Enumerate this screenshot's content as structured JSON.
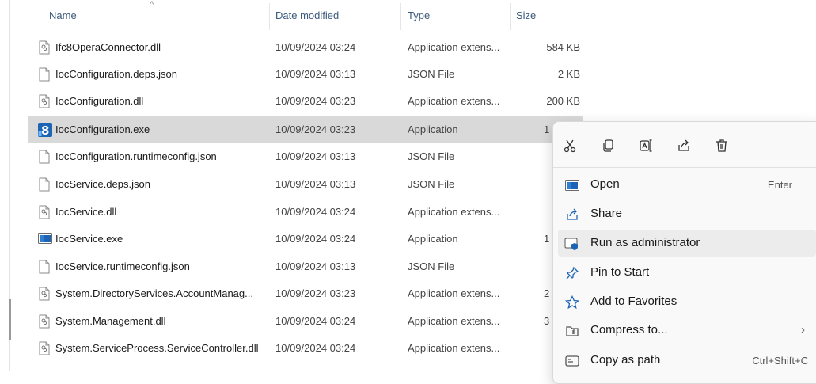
{
  "columns": {
    "name": "Name",
    "date": "Date modified",
    "type": "Type",
    "size": "Size"
  },
  "files": [
    {
      "name": "Ifc8OperaConnector.dll",
      "date": "10/09/2024 03:24",
      "type": "Application extens...",
      "size": "584 KB",
      "icon": "dll-icon"
    },
    {
      "name": "IocConfiguration.deps.json",
      "date": "10/09/2024 03:13",
      "type": "JSON File",
      "size": "2 KB",
      "icon": "json-file-icon"
    },
    {
      "name": "IocConfiguration.dll",
      "date": "10/09/2024 03:23",
      "type": "Application extens...",
      "size": "200 KB",
      "icon": "dll-icon"
    },
    {
      "name": "IocConfiguration.exe",
      "date": "10/09/2024 03:23",
      "type": "Application",
      "size": "1",
      "icon": "app-exe-icon"
    },
    {
      "name": "IocConfiguration.runtimeconfig.json",
      "date": "10/09/2024 03:13",
      "type": "JSON File",
      "size": "",
      "icon": "json-file-icon"
    },
    {
      "name": "IocService.deps.json",
      "date": "10/09/2024 03:13",
      "type": "JSON File",
      "size": "",
      "icon": "json-file-icon"
    },
    {
      "name": "IocService.dll",
      "date": "10/09/2024 03:24",
      "type": "Application extens...",
      "size": "",
      "icon": "dll-icon"
    },
    {
      "name": "IocService.exe",
      "date": "10/09/2024 03:24",
      "type": "Application",
      "size": "1",
      "icon": "window-exe-icon"
    },
    {
      "name": "IocService.runtimeconfig.json",
      "date": "10/09/2024 03:13",
      "type": "JSON File",
      "size": "",
      "icon": "json-file-icon"
    },
    {
      "name": "System.DirectoryServices.AccountManag...",
      "date": "10/09/2024 03:23",
      "type": "Application extens...",
      "size": "2",
      "icon": "dll-icon"
    },
    {
      "name": "System.Management.dll",
      "date": "10/09/2024 03:24",
      "type": "Application extens...",
      "size": "3",
      "icon": "dll-icon"
    },
    {
      "name": "System.ServiceProcess.ServiceController.dll",
      "date": "10/09/2024 03:24",
      "type": "Application extens...",
      "size": "",
      "icon": "dll-icon"
    }
  ],
  "context_menu": {
    "quick_actions": [
      "cut-icon",
      "copy-icon",
      "rename-icon",
      "share-icon",
      "delete-icon"
    ],
    "items": [
      {
        "label": "Open",
        "shortcut": "Enter",
        "icon": "open-window-icon"
      },
      {
        "label": "Share",
        "shortcut": "",
        "icon": "share-icon"
      },
      {
        "label": "Run as administrator",
        "shortcut": "",
        "icon": "shield-window-icon"
      },
      {
        "label": "Pin to Start",
        "shortcut": "",
        "icon": "pin-icon"
      },
      {
        "label": "Add to Favorites",
        "shortcut": "",
        "icon": "star-icon"
      },
      {
        "label": "Compress to...",
        "shortcut": "",
        "icon": "zip-icon",
        "submenu": true
      },
      {
        "label": "Copy as path",
        "shortcut": "Ctrl+Shift+C",
        "icon": "path-icon"
      }
    ]
  },
  "colors": {
    "selected_row": "#d9d9d9",
    "menu_hover": "#ececec",
    "header_text": "#3c5a7c",
    "accent_blue": "#1e64b4"
  }
}
